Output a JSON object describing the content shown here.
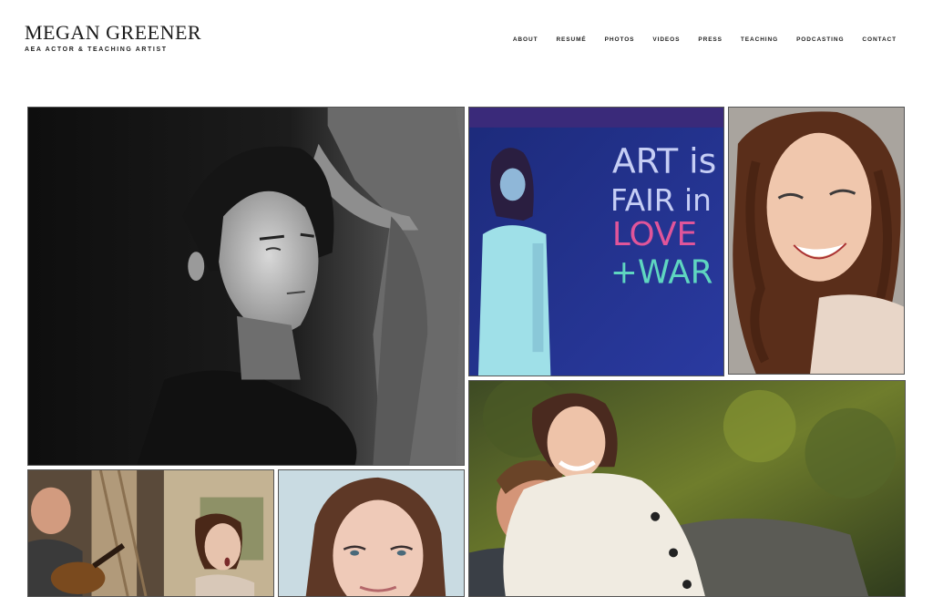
{
  "site": {
    "title": "MEGAN GREENER",
    "tagline": "AEA ACTOR & TEACHING ARTIST"
  },
  "nav": {
    "items": [
      "ABOUT",
      "RESUMÉ",
      "PHOTOS",
      "VIDEOS",
      "PRESS",
      "TEACHING",
      "PODCASTING",
      "CONTACT"
    ]
  },
  "gallery": {
    "photos": [
      {
        "id": "bw-portrait",
        "subject": "black and white portrait in profile"
      },
      {
        "id": "stage-art-is-fair",
        "subject": "stage photo with chalk sign",
        "sign_text": [
          "ART is",
          "FAIR in",
          "LOVE",
          "+WAR"
        ]
      },
      {
        "id": "headshot-smile",
        "subject": "smiling curly-haired headshot"
      },
      {
        "id": "couple-embrace",
        "subject": "couple embracing outdoors"
      },
      {
        "id": "stage-guitar",
        "subject": "stage scene with mandolin player"
      },
      {
        "id": "headshot-studio",
        "subject": "studio headshot"
      }
    ]
  },
  "colors": {
    "text": "#1a1a1a",
    "background": "#ffffff",
    "sign_pink": "#e0559a",
    "sign_teal": "#5fd6c0",
    "sign_white": "#c6cef5"
  }
}
